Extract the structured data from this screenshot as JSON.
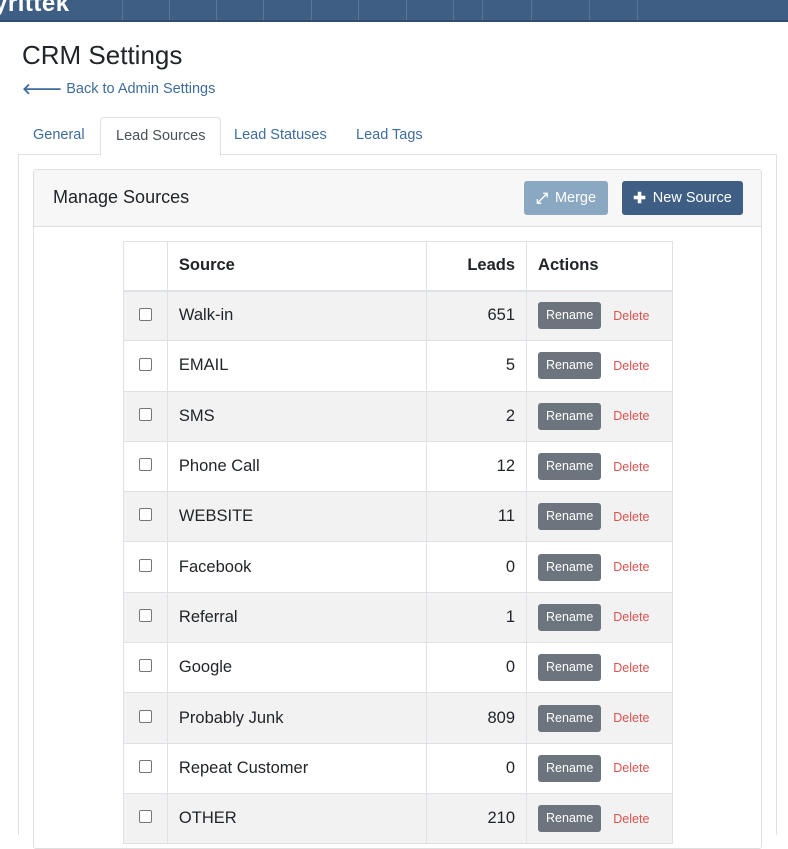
{
  "navbar": {
    "brand": "yrittek"
  },
  "page": {
    "title": "CRM Settings",
    "back_link": "Back to Admin Settings"
  },
  "tabs": [
    {
      "label": "General",
      "active": false
    },
    {
      "label": "Lead Sources",
      "active": true
    },
    {
      "label": "Lead Statuses",
      "active": false
    },
    {
      "label": "Lead Tags",
      "active": false
    }
  ],
  "card": {
    "title": "Manage Sources",
    "merge_label": "Merge",
    "new_source_label": "New Source"
  },
  "table": {
    "headers": {
      "source": "Source",
      "leads": "Leads",
      "actions": "Actions"
    },
    "rename_label": "Rename",
    "delete_label": "Delete",
    "rows": [
      {
        "source": "Walk-in",
        "leads": "651"
      },
      {
        "source": "EMAIL",
        "leads": "5"
      },
      {
        "source": "SMS",
        "leads": "2"
      },
      {
        "source": "Phone Call",
        "leads": "12"
      },
      {
        "source": "WEBSITE",
        "leads": "11"
      },
      {
        "source": "Facebook",
        "leads": "0"
      },
      {
        "source": "Referral",
        "leads": "1"
      },
      {
        "source": "Google",
        "leads": "0"
      },
      {
        "source": "Probably Junk",
        "leads": "809"
      },
      {
        "source": "Repeat Customer",
        "leads": "0"
      },
      {
        "source": "OTHER",
        "leads": "210"
      }
    ]
  },
  "colors": {
    "navbar": "#3e5f83",
    "link": "#3e6d9c",
    "delete": "#d9534f",
    "rename_button": "#6c757d",
    "merge_button": "#8aa8c2"
  }
}
